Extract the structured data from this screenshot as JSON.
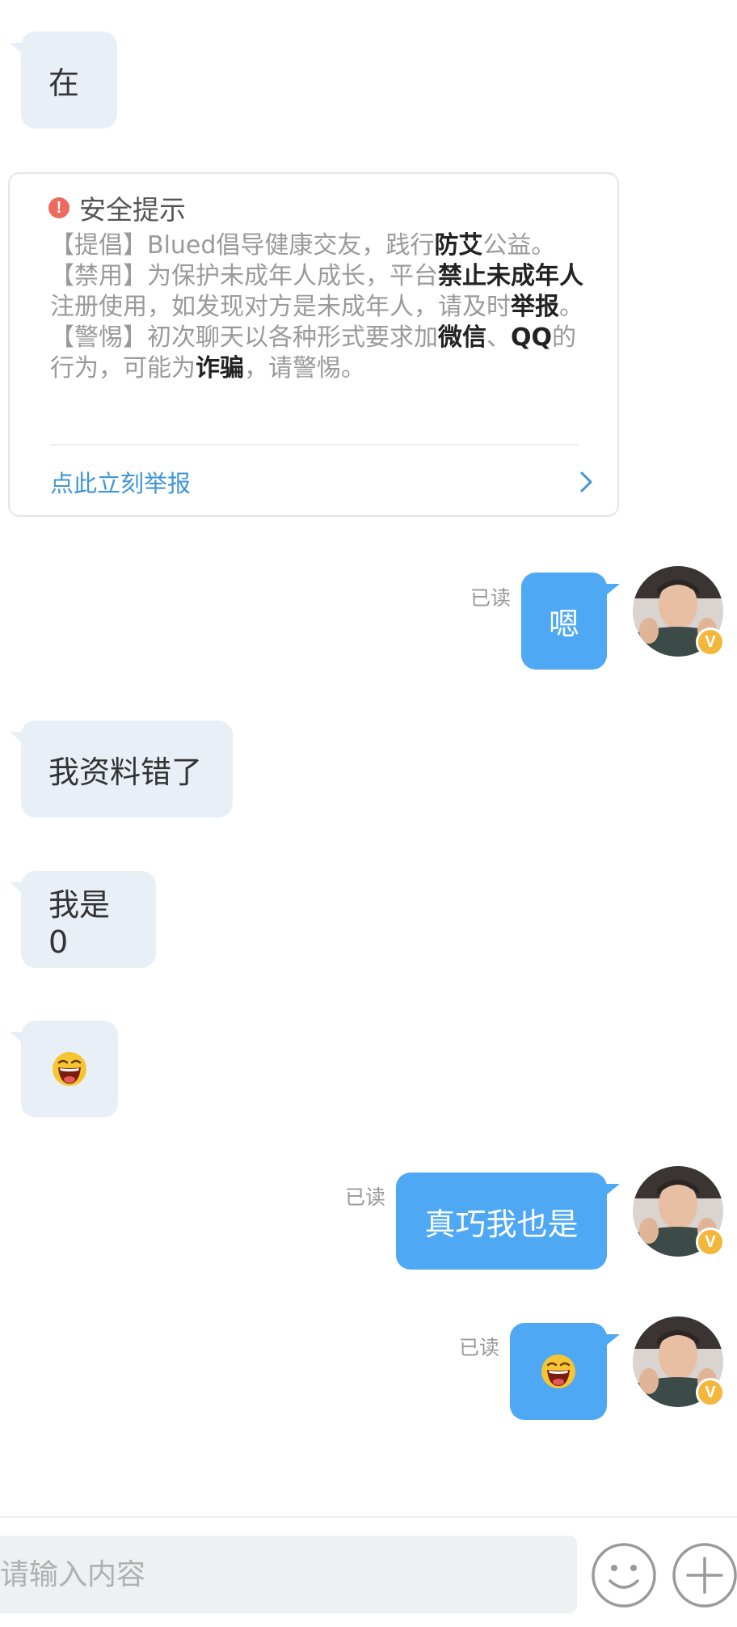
{
  "messages": {
    "m1": {
      "text": "在"
    },
    "m2": {
      "text": "嗯",
      "read": "已读"
    },
    "m3": {
      "text": "我资料错了"
    },
    "m4": {
      "text": "我是0"
    },
    "m5": {
      "emoji": "grinning-face-emoji"
    },
    "m6": {
      "text": "真巧我也是",
      "read": "已读"
    },
    "m7": {
      "emoji": "grinning-face-emoji",
      "read": "已读"
    }
  },
  "safety": {
    "title": "安全提示",
    "line1_pre": "【提倡】Blued倡导健康交友，践行",
    "line1_bold": "防艾",
    "line1_post": "公益。",
    "line2_pre": "【禁用】为保护未成年人成长，平台",
    "line2_bold": "禁止未成年人",
    "line2_mid": "注册使用，如发现对方是未成年人，请及时",
    "line2_bold2": "举报",
    "line2_post": "。",
    "line3_pre": "【警惕】初次聊天以各种形式要求加",
    "line3_bold": "微信",
    "line3_sep": "、",
    "line3_bold2": "QQ",
    "line3_mid": "的行为，可能为",
    "line3_bold3": "诈骗",
    "line3_post": "，请警惕。",
    "report_link": "点此立刻举报"
  },
  "avatar": {
    "badge": "V"
  },
  "input": {
    "placeholder": "请输入内容"
  },
  "colors": {
    "incoming_bubble": "#e9eff7",
    "outgoing_bubble": "#4ea8f4",
    "link": "#3f95d8",
    "warning": "#ee6a5f",
    "badge": "#f5b73b"
  }
}
